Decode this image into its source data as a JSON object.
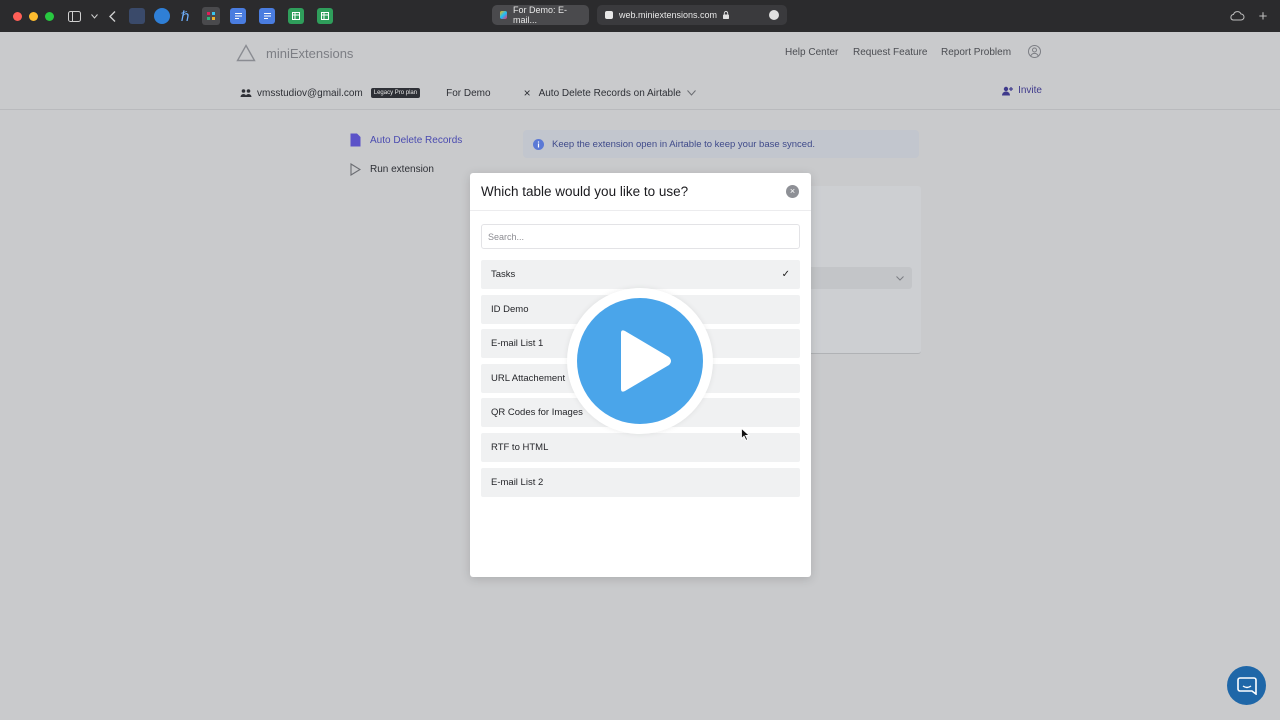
{
  "browser": {
    "tabs": [
      {
        "label": "For Demo: E-mail..."
      },
      {
        "label": "web.miniextensions.com"
      }
    ]
  },
  "header": {
    "logo_text": "miniExtensions",
    "nav": [
      "Help Center",
      "Request Feature",
      "Report Problem"
    ],
    "account": {
      "email": "vmsstudiov@gmail.com",
      "plan": "Legacy Pro plan",
      "base": "For Demo",
      "extension": "Auto Delete Records on Airtable"
    },
    "invite_label": "Invite"
  },
  "sidebar": {
    "items": [
      {
        "label": "Auto Delete Records",
        "active": true
      },
      {
        "label": "Run extension",
        "active": false
      }
    ]
  },
  "banner": {
    "text": "Keep the extension open in Airtable to keep your base synced."
  },
  "modal": {
    "title": "Which table would you like to use?",
    "search_placeholder": "Search...",
    "selected_mark": "✓",
    "tables": [
      "Tasks",
      "ID Demo",
      "E-mail List 1",
      "URL Attachement",
      "QR Codes for Images",
      "RTF to HTML",
      "E-mail List 2"
    ],
    "selected_index": 0
  },
  "colors": {
    "accent": "#3f3a8c",
    "play": "#4aa5ea",
    "chat": "#1f67a8"
  }
}
